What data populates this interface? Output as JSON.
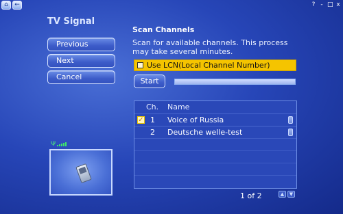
{
  "topbar": {
    "home_icon": "home-icon",
    "back_icon": "back-arrow-icon",
    "help": "?",
    "minimize": "-",
    "maximize": "□",
    "close": "x"
  },
  "page": {
    "title": "TV Signal"
  },
  "nav": {
    "previous": "Previous",
    "next": "Next",
    "cancel": "Cancel"
  },
  "scan": {
    "title": "Scan Channels",
    "description": "Scan for available channels. This process may take several minutes.",
    "lcn_label": "Use LCN(Local Channel Number)",
    "lcn_checked": false,
    "start_label": "Start",
    "progress_fraction": 0.0
  },
  "channels": {
    "columns": [
      "Ch.",
      "Name"
    ],
    "rows": [
      {
        "checked": true,
        "num": "1",
        "name": "Voice of Russia"
      },
      {
        "checked": false,
        "num": "2",
        "name": "Deutsche welle-test"
      }
    ],
    "pager": "1 of 2"
  },
  "preview": {
    "signal_icon": "signal-strength-icon",
    "device_icon": "tv-tuner-device-icon"
  }
}
